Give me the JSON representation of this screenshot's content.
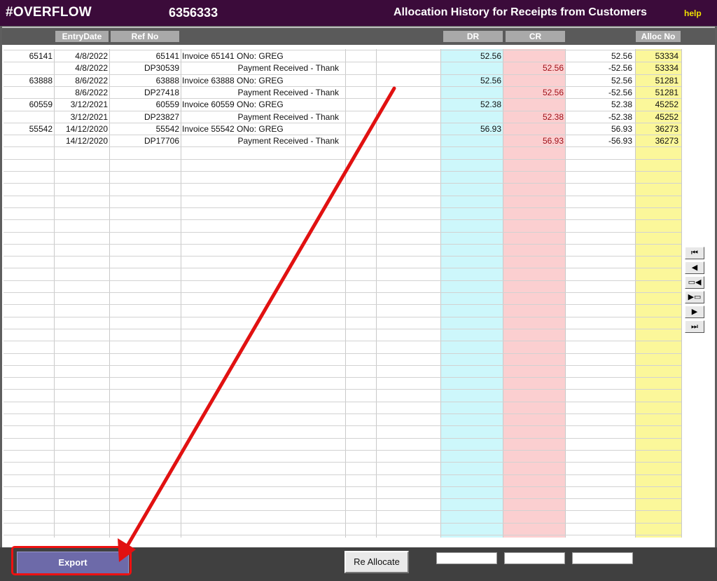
{
  "title": {
    "app": "#OVERFLOW",
    "account": "6356333",
    "screen": "Allocation History for Receipts from Customers",
    "help": "help"
  },
  "headers": {
    "entry_date": "EntryDate",
    "ref_no": "Ref No",
    "dr": "DR",
    "cr": "CR",
    "alloc_no": "Alloc No"
  },
  "rows": [
    {
      "doc": "65141",
      "date": "4/8/2022",
      "ref": "65141",
      "desc": "Invoice 65141 ONo: GREG",
      "dr": "52.56",
      "cr": "",
      "bal": "52.56",
      "alloc": "53334"
    },
    {
      "doc": "",
      "date": "4/8/2022",
      "ref": "DP30539",
      "desc": "Payment Received - Thank",
      "dr": "",
      "cr": "52.56",
      "bal": "-52.56",
      "alloc": "53334"
    },
    {
      "doc": "63888",
      "date": "8/6/2022",
      "ref": "63888",
      "desc": "Invoice 63888 ONo: GREG",
      "dr": "52.56",
      "cr": "",
      "bal": "52.56",
      "alloc": "51281"
    },
    {
      "doc": "",
      "date": "8/6/2022",
      "ref": "DP27418",
      "desc": "Payment Received - Thank",
      "dr": "",
      "cr": "52.56",
      "bal": "-52.56",
      "alloc": "51281"
    },
    {
      "doc": "60559",
      "date": "3/12/2021",
      "ref": "60559",
      "desc": "Invoice 60559 ONo: GREG",
      "dr": "52.38",
      "cr": "",
      "bal": "52.38",
      "alloc": "45252"
    },
    {
      "doc": "",
      "date": "3/12/2021",
      "ref": "DP23827",
      "desc": "Payment Received - Thank",
      "dr": "",
      "cr": "52.38",
      "bal": "-52.38",
      "alloc": "45252"
    },
    {
      "doc": "55542",
      "date": "14/12/2020",
      "ref": "55542",
      "desc": "Invoice 55542 ONo: GREG",
      "dr": "56.93",
      "cr": "",
      "bal": "56.93",
      "alloc": "36273"
    },
    {
      "doc": "",
      "date": "14/12/2020",
      "ref": "DP17706",
      "desc": "Payment Received - Thank",
      "dr": "",
      "cr": "56.93",
      "bal": "-56.93",
      "alloc": "36273"
    }
  ],
  "nav": [
    {
      "name": "first-record-icon",
      "glyph": "⏮"
    },
    {
      "name": "previous-record-icon",
      "glyph": "◀"
    },
    {
      "name": "previous-page-icon",
      "glyph": "▭◀"
    },
    {
      "name": "next-page-icon",
      "glyph": "▶▭"
    },
    {
      "name": "next-record-icon",
      "glyph": "▶"
    },
    {
      "name": "last-record-icon",
      "glyph": "⏭"
    }
  ],
  "buttons": {
    "export": "Export",
    "reallocate": "Re Allocate"
  },
  "colors": {
    "title_bar": "#3b0b3a",
    "dr_column": "#cdf7fb",
    "cr_column": "#fbcfd0",
    "alloc_column": "#fbf79a",
    "export_button": "#6d6aa9",
    "annotation": "#e11111"
  }
}
